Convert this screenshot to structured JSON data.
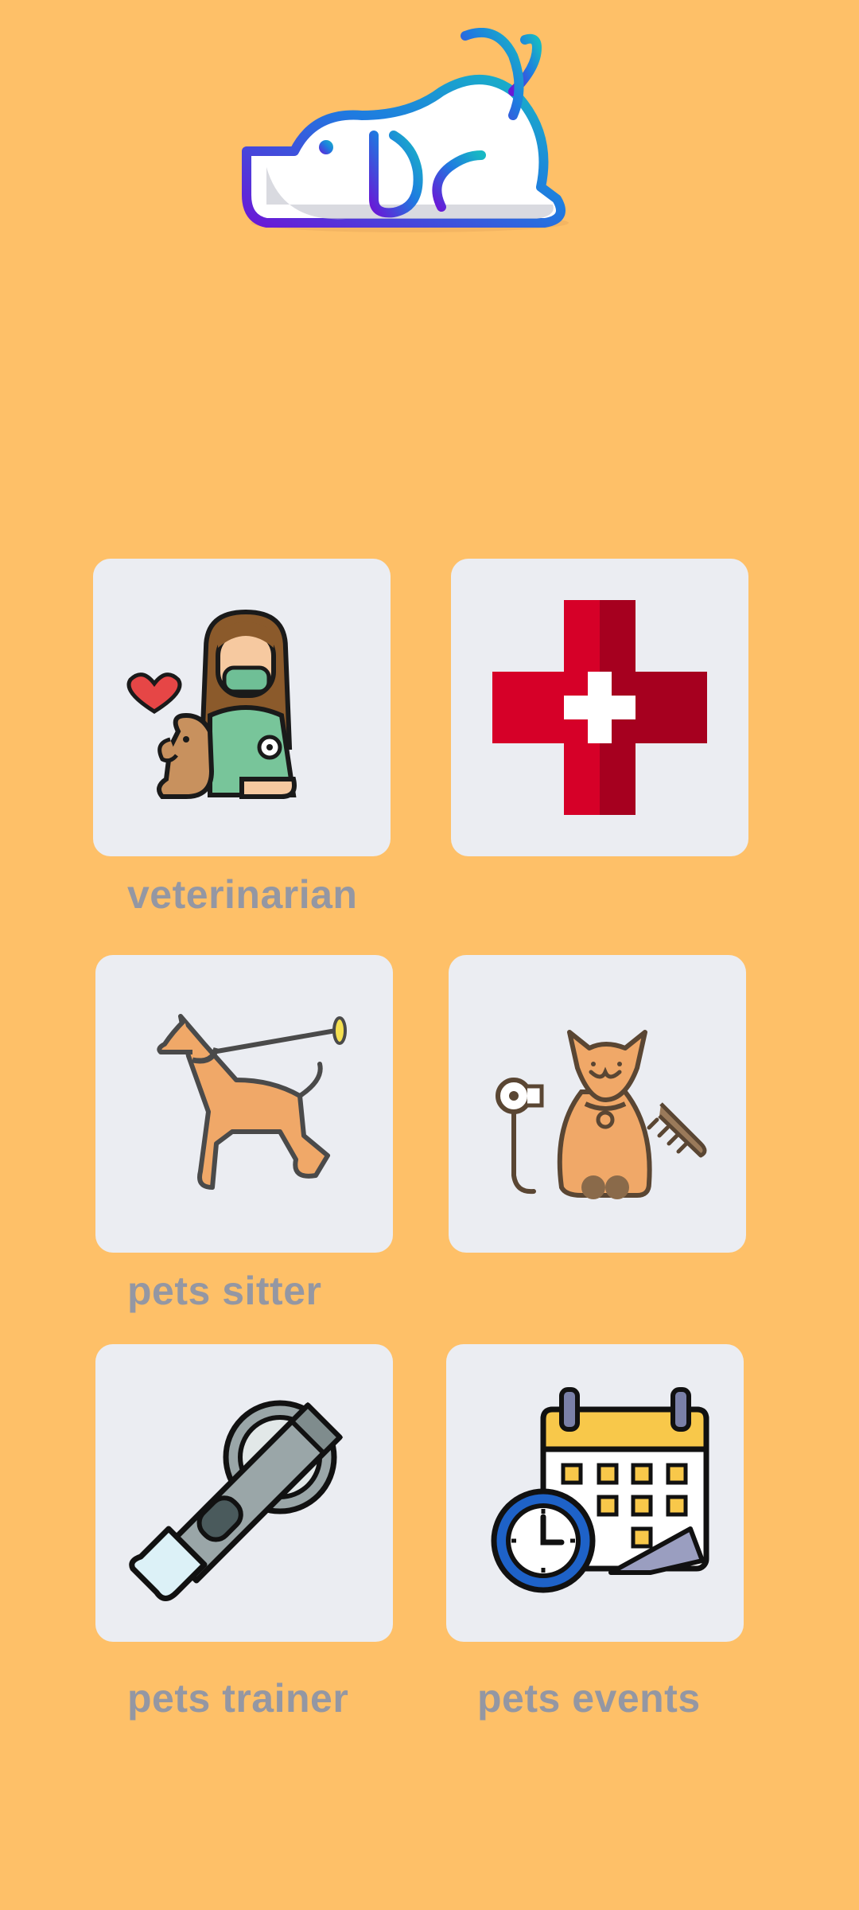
{
  "app": {
    "logo_icon": "sleeping-dog-logo-icon"
  },
  "services": [
    {
      "label": "veterinarian",
      "icon": "veterinarian-with-dog-icon"
    },
    {
      "label": "",
      "icon": "red-cross-icon"
    },
    {
      "label": "pets sitter",
      "icon": "dog-on-leash-icon"
    },
    {
      "label": "",
      "icon": "cat-grooming-icon"
    },
    {
      "label": "pets trainer",
      "icon": "dog-whistle-icon"
    },
    {
      "label": "pets events",
      "icon": "calendar-clock-icon"
    }
  ],
  "colors": {
    "background": "#FEC068",
    "tile": "#EBEDF2",
    "label": "#9497A3",
    "cross_red": "#D60028",
    "logo_gradient": [
      "#6A18D6",
      "#1E7BE0",
      "#18B8C4"
    ]
  }
}
